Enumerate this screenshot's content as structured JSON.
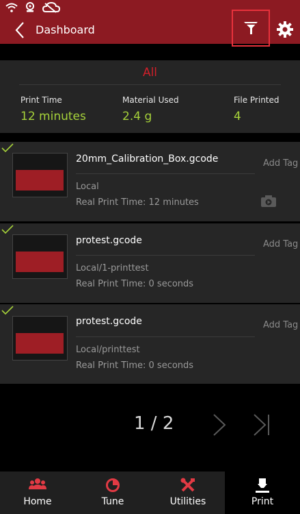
{
  "header": {
    "title": "Dashboard"
  },
  "summary": {
    "filter_label": "All",
    "stats": [
      {
        "label": "Print Time",
        "value": "12 minutes"
      },
      {
        "label": "Material Used",
        "value": "2.4 g"
      },
      {
        "label": "File Printed",
        "value": "4"
      }
    ]
  },
  "jobs": [
    {
      "name": "20mm_Calibration_Box.gcode",
      "source": "Local",
      "time": "Real Print Time: 12 minutes",
      "tag": "Add Tag"
    },
    {
      "name": "protest.gcode",
      "source": "Local/1-printtest",
      "time": "Real Print Time: 0 seconds",
      "tag": "Add Tag"
    },
    {
      "name": "protest.gcode",
      "source": "Local/printtest",
      "time": "Real Print Time: 0 seconds",
      "tag": "Add Tag"
    }
  ],
  "pagination": {
    "text": "1 / 2"
  },
  "nav": [
    {
      "label": "Home",
      "icon": "users-icon"
    },
    {
      "label": "Tune",
      "icon": "pie-icon"
    },
    {
      "label": "Utilities",
      "icon": "tools-icon"
    },
    {
      "label": "Print",
      "icon": "nozzle-icon"
    }
  ],
  "colors": {
    "brand_red": "#8c1a22",
    "accent_red": "#d11f2a",
    "value_green": "#a6d23a"
  }
}
